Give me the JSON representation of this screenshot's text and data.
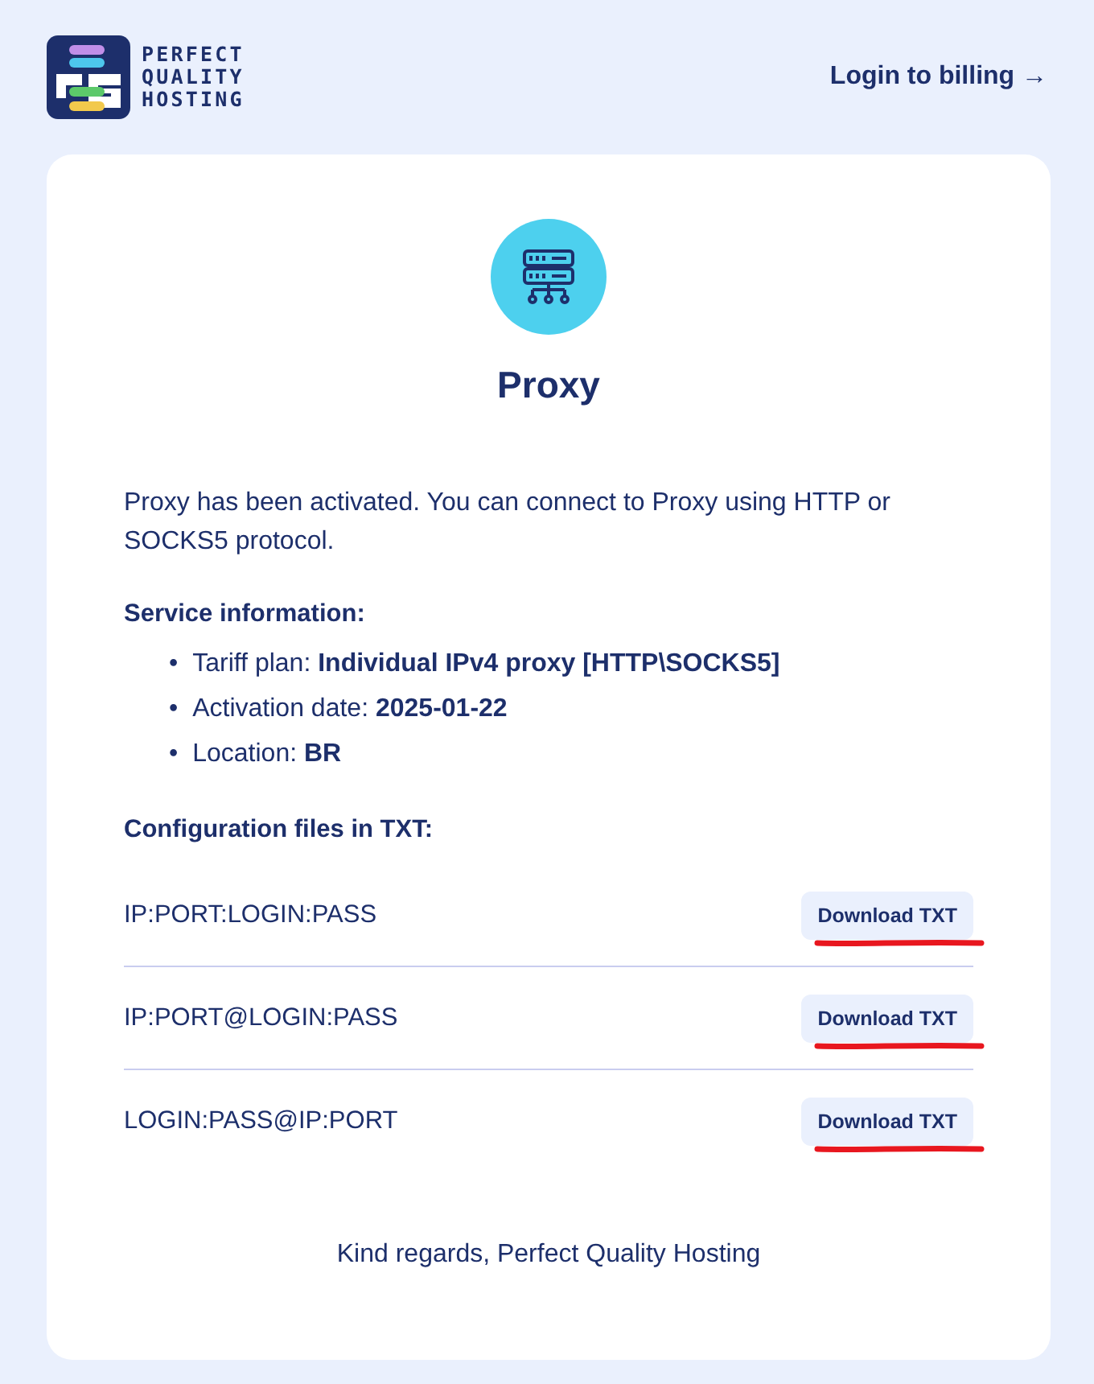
{
  "header": {
    "logo_lines": [
      "PERFECT",
      "QUALITY",
      "HOSTING"
    ],
    "login_link": "Login to billing →"
  },
  "card": {
    "title": "Proxy",
    "intro": "Proxy has been activated. You can connect to Proxy using HTTP or SOCKS5 protocol.",
    "service_heading": "Service information:",
    "service_items": [
      {
        "marker": "•",
        "label": "Tariff plan:",
        "value": "Individual IPv4 proxy [HTTP\\SOCKS5]"
      },
      {
        "marker": "•",
        "label": "Activation date:",
        "value": "2025-01-22"
      },
      {
        "marker": "•",
        "label": "Location:",
        "value": "BR"
      }
    ],
    "config_heading": "Configuration files in TXT:",
    "config_files": [
      {
        "format": "IP:PORT:LOGIN:PASS",
        "button": "Download TXT",
        "underlined": true
      },
      {
        "format": "IP:PORT@LOGIN:PASS",
        "button": "Download TXT",
        "underlined": true
      },
      {
        "format": "LOGIN:PASS@IP:PORT",
        "button": "Download TXT",
        "underlined": true
      }
    ],
    "footer": "Kind regards, Perfect Quality Hosting"
  }
}
